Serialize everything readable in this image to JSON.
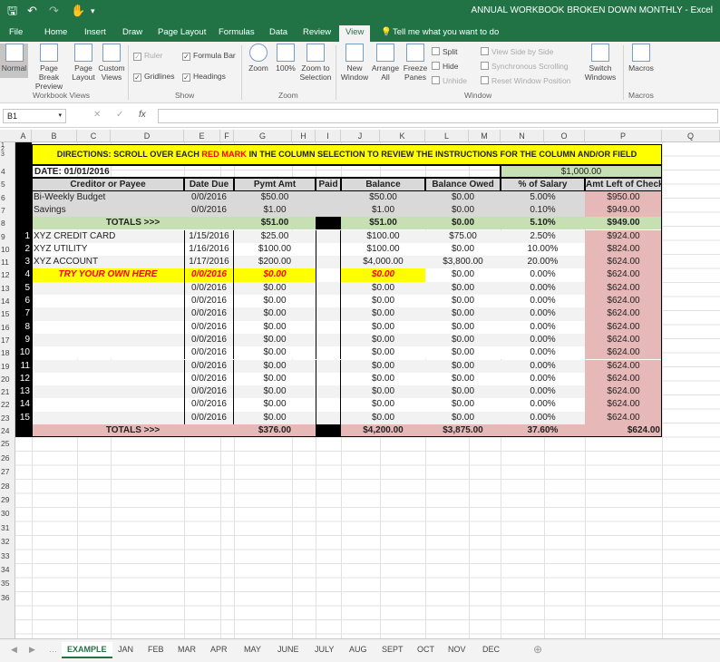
{
  "window": {
    "title": "ANNUAL WORKBOOK BROKEN DOWN MONTHLY - Excel"
  },
  "ribbon": {
    "tabs": [
      "File",
      "Home",
      "Insert",
      "Draw",
      "Page Layout",
      "Formulas",
      "Data",
      "Review",
      "View"
    ],
    "tell_me": "Tell me what you want to do",
    "workbook_views": {
      "normal": "Normal",
      "page_break_1": "Page Break",
      "page_break_2": "Preview",
      "page_layout_1": "Page",
      "page_layout_2": "Layout",
      "custom_1": "Custom",
      "custom_2": "Views",
      "group": "Workbook Views"
    },
    "show": {
      "ruler": "Ruler",
      "formula_bar": "Formula Bar",
      "gridlines": "Gridlines",
      "headings": "Headings",
      "group": "Show"
    },
    "zoom": {
      "zoom": "Zoom",
      "zoom100": "100%",
      "zoom_sel_1": "Zoom to",
      "zoom_sel_2": "Selection",
      "group": "Zoom"
    },
    "window": {
      "new_1": "New",
      "new_2": "Window",
      "arrange_1": "Arrange",
      "arrange_2": "All",
      "freeze_1": "Freeze",
      "freeze_2": "Panes",
      "split": "Split",
      "hide": "Hide",
      "unhide": "Unhide",
      "side": "View Side by Side",
      "sync": "Synchronous Scrolling",
      "reset": "Reset Window Position",
      "switch_1": "Switch",
      "switch_2": "Windows",
      "group": "Window"
    },
    "macros": {
      "macros": "Macros",
      "group": "Macros"
    }
  },
  "formula_bar": {
    "name_box": "B1",
    "fx": "fx",
    "cancel": "✕",
    "enter": "✓"
  },
  "columns": [
    "A",
    "B",
    "C",
    "D",
    "E",
    "F",
    "G",
    "H",
    "I",
    "J",
    "K",
    "L",
    "M",
    "N",
    "O",
    "P",
    "Q"
  ],
  "rows": [
    "1",
    "2",
    "3",
    "4",
    "5",
    "6",
    "7",
    "8",
    "9",
    "10",
    "11",
    "12",
    "13",
    "14",
    "15",
    "16",
    "17",
    "18",
    "19",
    "20",
    "21",
    "22",
    "23",
    "24",
    "25",
    "26",
    "27",
    "28",
    "29",
    "30",
    "31",
    "32",
    "33",
    "34",
    "35",
    "36"
  ],
  "sheet": {
    "directions_1": "DIRECTIONS: SCROLL OVER EACH ",
    "directions_red": "RED MARK",
    "directions_2": " IN THE COLUMN SELECTION TO REVIEW THE INSTRUCTIONS FOR THE COLUMN AND/OR FIELD",
    "date_label": "DATE: 01/01/2016",
    "salary": "$1,000.00",
    "headers": [
      "Creditor or Payee",
      "Date Due",
      "Pymt Amt",
      "Paid",
      "Balance",
      "Balance Owed",
      "% of Salary",
      "Amt Left of Check"
    ],
    "budget_rows": [
      {
        "name": "Bi-Weekly Budget",
        "date": "0/0/2016",
        "pymt": "$50.00",
        "balance": "$50.00",
        "owed": "$0.00",
        "pct": "5.00%",
        "left": "$950.00"
      },
      {
        "name": "Savings",
        "date": "0/0/2016",
        "pymt": "$1.00",
        "balance": "$1.00",
        "owed": "$0.00",
        "pct": "0.10%",
        "left": "$949.00"
      }
    ],
    "totals1": {
      "label": "TOTALS >>>",
      "pymt": "$51.00",
      "balance": "$51.00",
      "owed": "$0.00",
      "pct": "5.10%",
      "left": "$949.00"
    },
    "items": [
      {
        "num": "1",
        "name": "XYZ CREDIT CARD",
        "date": "1/15/2016",
        "pymt": "$25.00",
        "balance": "$100.00",
        "owed": "$75.00",
        "pct": "2.50%",
        "left": "$924.00"
      },
      {
        "num": "2",
        "name": "XYZ UTILITY",
        "date": "1/16/2016",
        "pymt": "$100.00",
        "balance": "$100.00",
        "owed": "$0.00",
        "pct": "10.00%",
        "left": "$824.00"
      },
      {
        "num": "3",
        "name": "XYZ ACCOUNT",
        "date": "1/17/2016",
        "pymt": "$200.00",
        "balance": "$4,000.00",
        "owed": "$3,800.00",
        "pct": "20.00%",
        "left": "$624.00"
      },
      {
        "num": "4",
        "name": "TRY YOUR OWN HERE",
        "date": "0/0/2016",
        "pymt": "$0.00",
        "balance": "$0.00",
        "owed": "$0.00",
        "pct": "0.00%",
        "left": "$624.00"
      },
      {
        "num": "5",
        "name": "",
        "date": "0/0/2016",
        "pymt": "$0.00",
        "balance": "$0.00",
        "owed": "$0.00",
        "pct": "0.00%",
        "left": "$624.00"
      },
      {
        "num": "6",
        "name": "",
        "date": "0/0/2016",
        "pymt": "$0.00",
        "balance": "$0.00",
        "owed": "$0.00",
        "pct": "0.00%",
        "left": "$624.00"
      },
      {
        "num": "7",
        "name": "",
        "date": "0/0/2016",
        "pymt": "$0.00",
        "balance": "$0.00",
        "owed": "$0.00",
        "pct": "0.00%",
        "left": "$624.00"
      },
      {
        "num": "8",
        "name": "",
        "date": "0/0/2016",
        "pymt": "$0.00",
        "balance": "$0.00",
        "owed": "$0.00",
        "pct": "0.00%",
        "left": "$624.00"
      },
      {
        "num": "9",
        "name": "",
        "date": "0/0/2016",
        "pymt": "$0.00",
        "balance": "$0.00",
        "owed": "$0.00",
        "pct": "0.00%",
        "left": "$624.00"
      },
      {
        "num": "10",
        "name": "",
        "date": "0/0/2016",
        "pymt": "$0.00",
        "balance": "$0.00",
        "owed": "$0.00",
        "pct": "0.00%",
        "left": "$624.00"
      },
      {
        "num": "11",
        "name": "",
        "date": "0/0/2016",
        "pymt": "$0.00",
        "balance": "$0.00",
        "owed": "$0.00",
        "pct": "0.00%",
        "left": "$624.00"
      },
      {
        "num": "12",
        "name": "",
        "date": "0/0/2016",
        "pymt": "$0.00",
        "balance": "$0.00",
        "owed": "$0.00",
        "pct": "0.00%",
        "left": "$624.00"
      },
      {
        "num": "13",
        "name": "",
        "date": "0/0/2016",
        "pymt": "$0.00",
        "balance": "$0.00",
        "owed": "$0.00",
        "pct": "0.00%",
        "left": "$624.00"
      },
      {
        "num": "14",
        "name": "",
        "date": "0/0/2016",
        "pymt": "$0.00",
        "balance": "$0.00",
        "owed": "$0.00",
        "pct": "0.00%",
        "left": "$624.00"
      },
      {
        "num": "15",
        "name": "",
        "date": "0/0/2016",
        "pymt": "$0.00",
        "balance": "$0.00",
        "owed": "$0.00",
        "pct": "0.00%",
        "left": "$624.00"
      }
    ],
    "totals2": {
      "label": "TOTALS >>>",
      "pymt": "$376.00",
      "balance": "$4,200.00",
      "owed": "$3,875.00",
      "pct": "37.60%",
      "left": "$624.00"
    }
  },
  "sheet_tabs": [
    "EXAMPLE",
    "JAN",
    "FEB",
    "MAR",
    "APR",
    "MAY",
    "JUNE",
    "JULY",
    "AUG",
    "SEPT",
    "OCT",
    "NOV",
    "DEC"
  ],
  "colors": {
    "excel_green": "#217346",
    "header_gray": "#d9d9d9",
    "totals_green": "#c6e0b4",
    "left_pink": "#e6b8b7",
    "directions_yellow": "#ffff00",
    "red_text": "#ff0000"
  }
}
